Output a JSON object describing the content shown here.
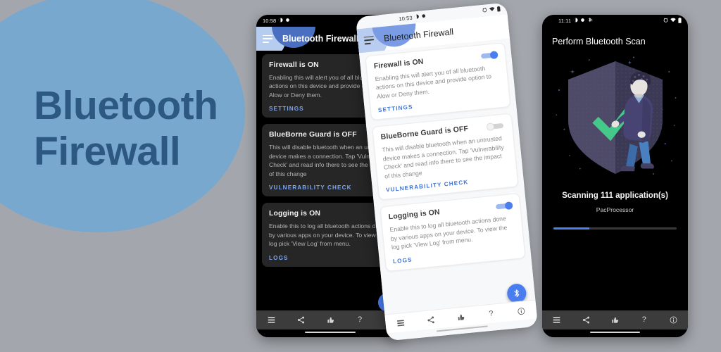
{
  "promo": {
    "title_line_1": "Bluetooth",
    "title_line_2": "Firewall",
    "blob_color": "#79a8cf",
    "text_color": "#2d5882",
    "background_color": "#a3a7ad"
  },
  "phone_1": {
    "theme": "dark",
    "status_bar": {
      "time": "10:58",
      "left_icons": [
        "do-not-disturb-icon",
        "dot-icon"
      ],
      "right_icons": [
        "alarm-icon",
        "wifi-icon",
        "battery-icon"
      ]
    },
    "app_bar": {
      "menu_icon": "hamburger-menu-icon",
      "title": "Bluetooth Firewall",
      "overflow_icon": "kebab-menu-icon"
    },
    "cards": [
      {
        "title": "Firewall is ON",
        "switch_state": "on",
        "body": "Enabling this will alert you of all bluetooth actions on this device and provide option to Alow or Deny them.",
        "action": "SETTINGS"
      },
      {
        "title": "BlueBorne Guard is OFF",
        "switch_state": "off",
        "body": "This will disable bluetooth when an untrusted device makes a connection. Tap 'Vulnerability Check' and read info there to see the impact of this change",
        "action": "VULNERABILITY CHECK"
      },
      {
        "title": "Logging is ON",
        "switch_state": "on",
        "body": "Enable this to log all bluetooth actions done by various apps on your device. To view the log pick 'View Log' from menu.",
        "action": "LOGS"
      }
    ],
    "fab": {
      "icon": "bluetooth-icon",
      "color": "#4a7ef0"
    },
    "bottom_nav": [
      "list-icon",
      "share-icon",
      "thumbs-up-icon",
      "help-question-icon",
      "info-icon"
    ]
  },
  "phone_2": {
    "theme": "light",
    "status_bar": {
      "time": "10:53",
      "left_icons": [
        "do-not-disturb-icon",
        "dot-icon"
      ],
      "right_icons": [
        "alarm-icon",
        "wifi-icon",
        "battery-icon"
      ]
    },
    "app_bar": {
      "menu_icon": "hamburger-menu-icon",
      "title": "Bluetooth Firewall"
    },
    "cards": [
      {
        "title": "Firewall is ON",
        "switch_state": "on",
        "body": "Enabling this will alert you of all bluetooth actions on this device and provide option to Alow or Deny them.",
        "action": "SETTINGS"
      },
      {
        "title": "BlueBorne Guard is OFF",
        "switch_state": "off",
        "body": "This will disable bluetooth when an untrusted device makes a connection. Tap 'Vulnerability Check' and read info there to see the impact of this change",
        "action": "VULNERABILITY CHECK"
      },
      {
        "title": "Logging is ON",
        "switch_state": "on",
        "body": "Enable this to log all bluetooth actions done by various apps on your device. To view the log pick 'View Log' from menu.",
        "action": "LOGS"
      }
    ],
    "fab": {
      "icon": "bluetooth-icon",
      "color": "#4a7ef0"
    },
    "bottom_nav": [
      "list-icon",
      "share-icon",
      "thumbs-up-icon",
      "help-question-icon",
      "info-icon"
    ]
  },
  "phone_3": {
    "theme": "dark",
    "status_bar": {
      "time": "11:11",
      "left_icons": [
        "do-not-disturb-icon",
        "dot-icon",
        "bluetooth-audio-icon"
      ],
      "right_icons": [
        "alarm-icon",
        "wifi-icon",
        "battery-icon"
      ]
    },
    "screen_title": "Perform Bluetooth Scan",
    "illustration": "shield-checkmark-person-illustration",
    "scan_status": "Scanning 111 application(s)",
    "scan_current_item": "PacProcessor",
    "progress_percent": 29,
    "progress_color": "#4a86e8",
    "bottom_nav": [
      "list-icon",
      "share-icon",
      "thumbs-up-icon",
      "help-question-icon",
      "info-icon"
    ]
  }
}
